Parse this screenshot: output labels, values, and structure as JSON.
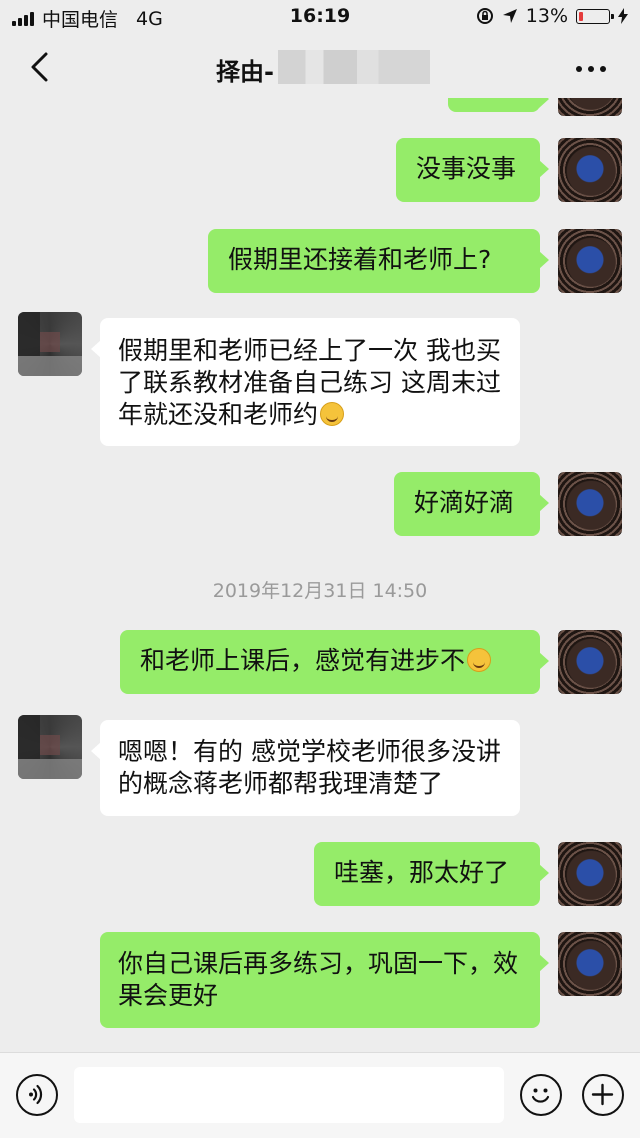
{
  "status_bar": {
    "carrier": "中国电信",
    "network": "4G",
    "time": "16:19",
    "battery_percent": "13%",
    "battery_level": 0.13,
    "battery_color": "#e43b3b"
  },
  "header": {
    "title": "择由-",
    "back_icon": "chevron-left-icon",
    "more_icon": "more-dots-icon"
  },
  "messages": [
    {
      "sender": "me",
      "text": "没事没事"
    },
    {
      "sender": "me",
      "text": "假期里还接着和老师上?"
    },
    {
      "sender": "other",
      "text": "假期里和老师已经上了一次 我也买了联系教材准备自己练习 这周末过年就还没和老师约",
      "emoji": "laughing-tears-emoji"
    },
    {
      "sender": "me",
      "text": "好滴好滴"
    },
    {
      "type": "timestamp",
      "text": "2019年12月31日 14:50"
    },
    {
      "sender": "me",
      "text": "和老师上课后，感觉有进步不",
      "emoji": "thinking-emoji"
    },
    {
      "sender": "other",
      "text": "嗯嗯！有的 感觉学校老师很多没讲的概念蒋老师都帮我理清楚了"
    },
    {
      "sender": "me",
      "text": "哇塞，那太好了"
    },
    {
      "sender": "me",
      "text": "你自己课后再多练习，巩固一下，效果会更好"
    }
  ],
  "input_bar": {
    "voice_icon": "voice-icon",
    "emoji_icon": "smiley-icon",
    "plus_icon": "plus-icon",
    "input_value": ""
  },
  "colors": {
    "my_bubble": "#95ec69",
    "other_bubble": "#ffffff",
    "background": "#ededed"
  }
}
